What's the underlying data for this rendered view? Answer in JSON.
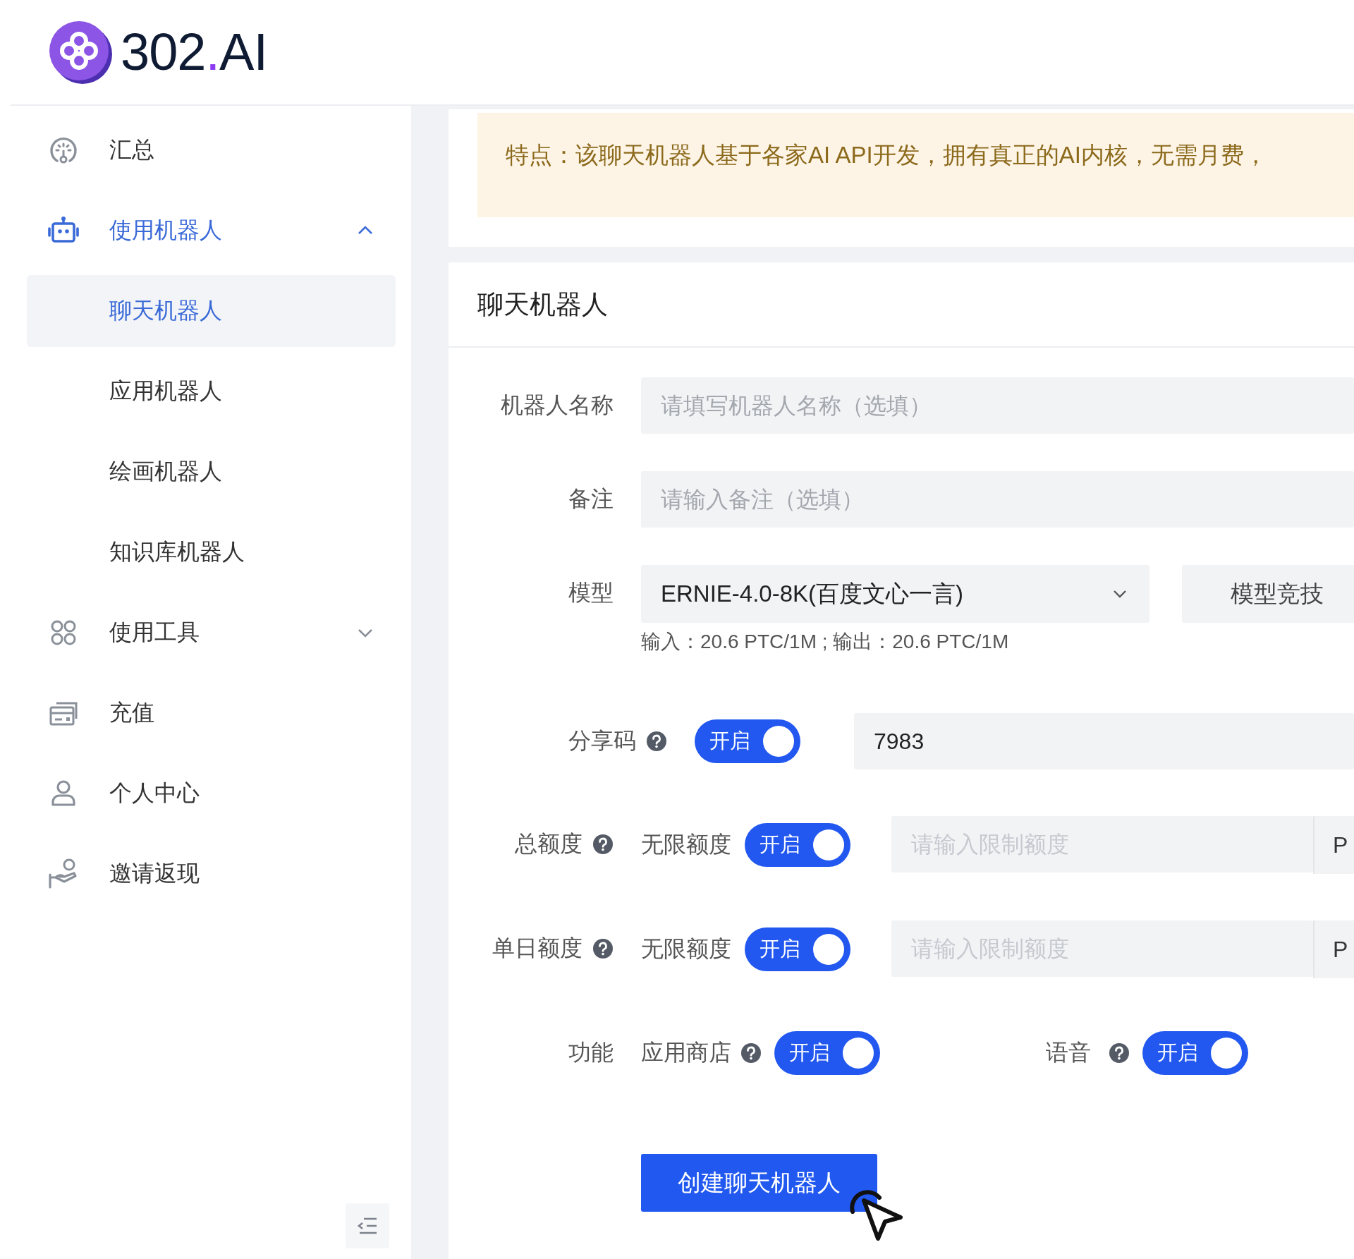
{
  "logo": {
    "parts": [
      {
        "text": "302",
        "accent": false
      },
      {
        "text": ".",
        "accent": true
      },
      {
        "text": "AI",
        "accent": false
      }
    ]
  },
  "sidebar": {
    "items": [
      {
        "kind": "link",
        "label": "汇总",
        "selected": false
      },
      {
        "kind": "group",
        "label": "使用机器人",
        "selected": false,
        "expanded": true,
        "children": [
          {
            "label": "聊天机器人",
            "selected": true
          },
          {
            "label": "应用机器人",
            "selected": false
          },
          {
            "label": "绘画机器人",
            "selected": false
          },
          {
            "label": "知识库机器人",
            "selected": false
          }
        ]
      },
      {
        "kind": "group",
        "label": "使用工具",
        "selected": false,
        "expanded": false
      },
      {
        "kind": "link",
        "label": "充值",
        "selected": false
      },
      {
        "kind": "link",
        "label": "个人中心",
        "selected": false
      },
      {
        "kind": "link",
        "label": "邀请返现",
        "selected": false
      }
    ]
  },
  "notice": {
    "text": "特点：该聊天机器人基于各家AI API开发，拥有真正的AI内核，无需月费，"
  },
  "form": {
    "title": "聊天机器人",
    "rows": [
      {
        "kind": "text",
        "label": "机器人名称",
        "placeholder": "请填写机器人名称（选填）"
      },
      {
        "kind": "text",
        "label": "备注",
        "placeholder": "请输入备注（选填）"
      },
      {
        "kind": "select",
        "label": "模型",
        "value": "ERNIE-4.0-8K(百度文心一言)",
        "extra": "模型竞技",
        "hint": "输入：20.6 PTC/1M ; 输出：20.6 PTC/1M"
      },
      {
        "kind": "share",
        "label": "分享码",
        "help": true,
        "toggle": {
          "label": "开启",
          "on": true
        },
        "value": "7983"
      },
      {
        "kind": "quota",
        "label": "总额度",
        "help": true,
        "option": "无限额度",
        "toggle": {
          "label": "开启",
          "on": true
        },
        "placeholder": "请输入限制额度",
        "unit": "P"
      },
      {
        "kind": "quota",
        "label": "单日额度",
        "help": true,
        "option": "无限额度",
        "toggle": {
          "label": "开启",
          "on": true
        },
        "placeholder": "请输入限制额度",
        "unit": "P"
      },
      {
        "kind": "features",
        "label": "功能",
        "items": [
          {
            "label": "应用商店",
            "help": true,
            "toggle": {
              "label": "开启",
              "on": true
            }
          },
          {
            "label": "语音",
            "help": true,
            "toggle": {
              "label": "开启",
              "on": true
            }
          }
        ]
      }
    ],
    "submit": "创建聊天机器人"
  }
}
